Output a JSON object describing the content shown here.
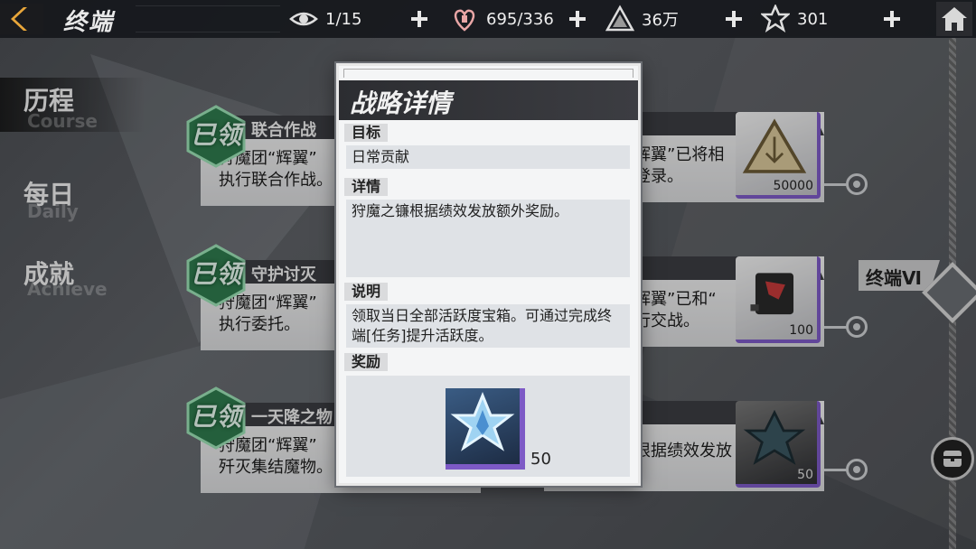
{
  "header": {
    "title": "终端",
    "resources": [
      {
        "icon": "eye-icon",
        "value": "1/15"
      },
      {
        "icon": "heart-icon",
        "value": "695/336"
      },
      {
        "icon": "coin-triangle-icon",
        "value": "36万"
      },
      {
        "icon": "star-crystal-icon",
        "value": "301"
      }
    ]
  },
  "tabs": [
    {
      "cn": "历程",
      "en": "Course",
      "active": true
    },
    {
      "cn": "每日",
      "en": "Daily",
      "active": false
    },
    {
      "cn": "成就",
      "en": "Achieve",
      "active": false
    }
  ],
  "cards_left": [
    {
      "title": "联合作战",
      "desc": "狩魔团“辉翼”\n执行联合作战。",
      "claimed": "已领"
    },
    {
      "title": "守护讨灭",
      "desc": "狩魔团“辉翼”\n执行委托。",
      "claimed": "已领"
    },
    {
      "title": "一天降之物",
      "desc": "狩魔团“辉翼”\n歼灭集结魔物。",
      "claimed": "已领"
    }
  ],
  "cards_right": [
    {
      "desc": "辉翼”已将相\n登录。",
      "reward_qty": "50000",
      "reward_icon": "triangle-emblem-icon"
    },
    {
      "desc": "辉翼”已和“\n行交战。",
      "reward_qty": "100",
      "reward_icon": "red-chip-icon"
    },
    {
      "desc": "根据绩效发放",
      "reward_qty": "50",
      "reward_icon": "dark-star-icon"
    }
  ],
  "terminal_label": "终端Ⅵ",
  "modal": {
    "title": "战略详情",
    "goal_label": "目标",
    "goal_text": "日常贡献",
    "detail_label": "详情",
    "detail_text": "狩魔之镰根据绩效发放额外奖励。",
    "note_label": "说明",
    "note_text": "领取当日全部活跃度宝箱。可通过完成终端[任务]提升活跃度。",
    "reward_label": "奖励",
    "reward_qty": "50",
    "reward_icon": "blue-star-crystal-icon"
  }
}
